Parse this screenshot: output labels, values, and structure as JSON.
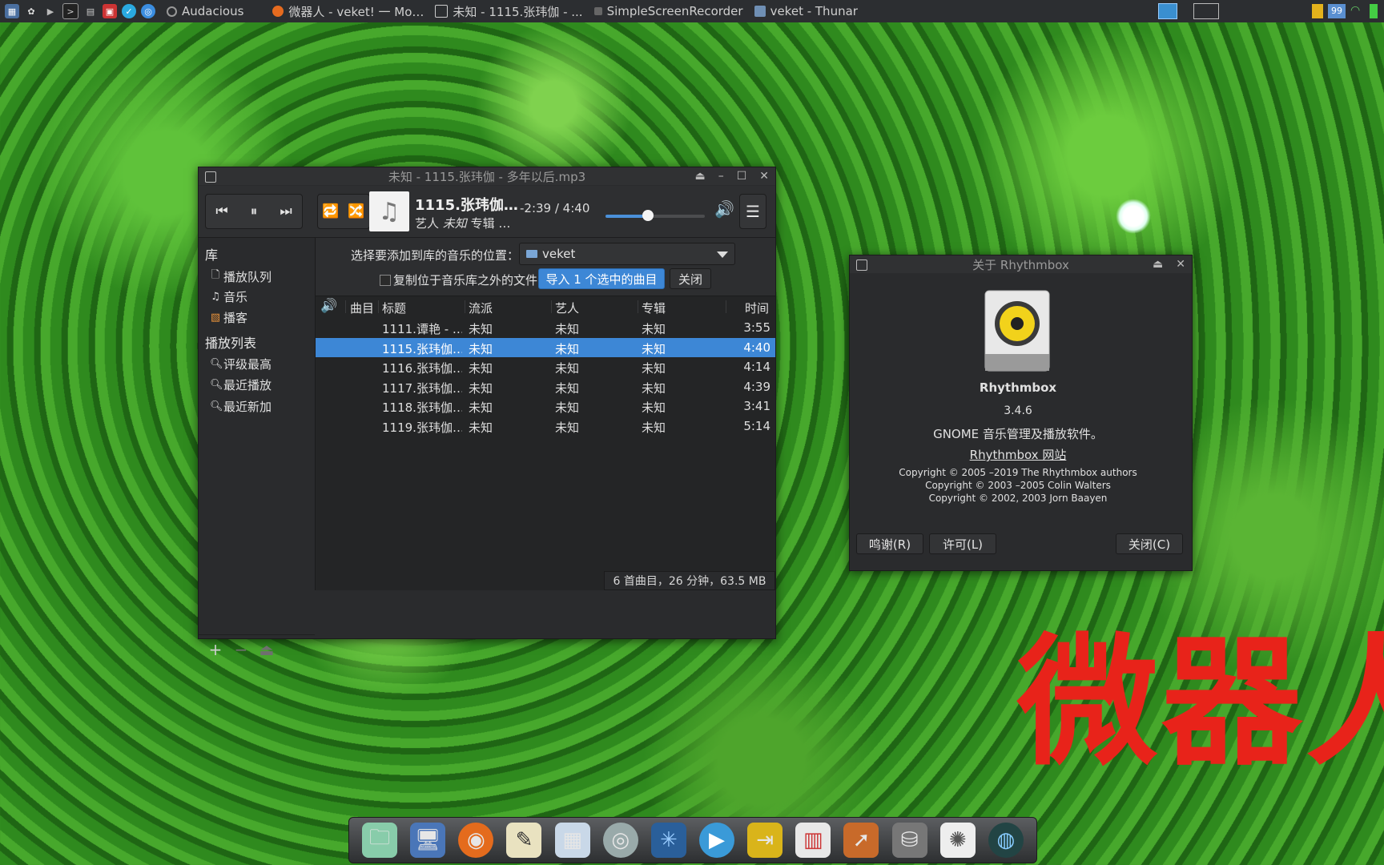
{
  "taskbar": {
    "tasks": [
      "Audacious",
      "微器人 - veket! 一 Mo…",
      "未知 - 1115.张玮伽 - ...",
      "SimpleScreenRecorder",
      "veket - Thunar"
    ],
    "battery": "99"
  },
  "wallpaper": {
    "overlay_text": "微器人"
  },
  "player": {
    "window_title": "未知 - 1115.张玮伽 - 多年以后.mp3",
    "now_playing": {
      "title": "1115.张玮伽…",
      "artist_label": "艺人",
      "artist": "未知",
      "album_label": "专辑",
      "album_trunc": "…",
      "time": "-2:39 / 4:40",
      "progress": 0.43
    },
    "sidebar": {
      "library_header": "库",
      "library_items": [
        "播放队列",
        "音乐",
        "播客"
      ],
      "playlists_header": "播放列表",
      "playlist_items": [
        "评级最高",
        "最近播放",
        "最近新加"
      ]
    },
    "import": {
      "label": "选择要添加到库的音乐的位置：",
      "location": "veket",
      "copy_checkbox_label": "复制位于音乐库之外的文件",
      "import_button": "导入 1 个选中的曲目",
      "close_button": "关闭"
    },
    "columns": [
      "曲目",
      "标题",
      "流派",
      "艺人",
      "专辑",
      "时间"
    ],
    "tracks": [
      {
        "title": "1111.谭艳 - …",
        "genre": "未知",
        "artist": "未知",
        "album": "未知",
        "time": "3:55"
      },
      {
        "title": "1115.张玮伽…",
        "genre": "未知",
        "artist": "未知",
        "album": "未知",
        "time": "4:40"
      },
      {
        "title": "1116.张玮伽…",
        "genre": "未知",
        "artist": "未知",
        "album": "未知",
        "time": "4:14"
      },
      {
        "title": "1117.张玮伽…",
        "genre": "未知",
        "artist": "未知",
        "album": "未知",
        "time": "4:39"
      },
      {
        "title": "1118.张玮伽…",
        "genre": "未知",
        "artist": "未知",
        "album": "未知",
        "time": "3:41"
      },
      {
        "title": "1119.张玮伽…",
        "genre": "未知",
        "artist": "未知",
        "album": "未知",
        "time": "5:14"
      }
    ],
    "selected_track": 1,
    "status": "6 首曲目，26 分钟，63.5 MB"
  },
  "about": {
    "window_title": "关于 Rhythmbox",
    "app_name": "Rhythmbox",
    "version": "3.4.6",
    "description": "GNOME 音乐管理及播放软件。",
    "website": "Rhythmbox 网站",
    "copyright": [
      "Copyright © 2005 –2019 The Rhythmbox authors",
      "Copyright © 2003 –2005 Colin Walters",
      "Copyright © 2002, 2003 Jorn Baayen"
    ],
    "credits_button": "鸣谢(R)",
    "license_button": "许可(L)",
    "close_button": "关闭(C)"
  },
  "colors": {
    "accent": "#3d87d6",
    "overlay_text": "#e8231a"
  }
}
